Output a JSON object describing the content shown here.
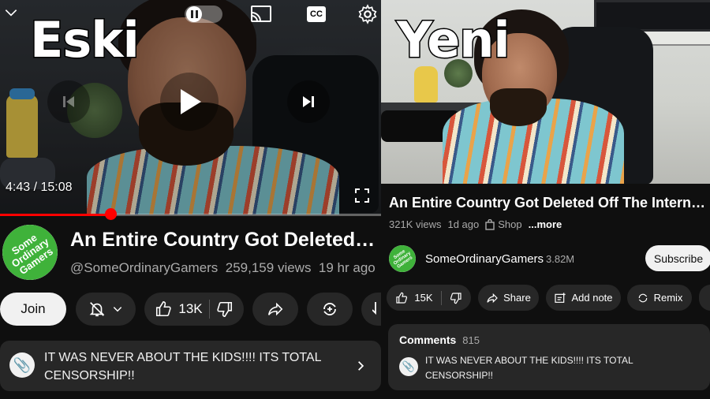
{
  "labels": {
    "old": "Eski",
    "new": "Yeni"
  },
  "video": {
    "title": "An Entire Country Got Deleted Off The Internet...",
    "channel": "SomeOrdinaryGamers",
    "channel_handle": "@SomeOrdinaryGamers",
    "avatar_text": "Some Ordinary Gamers"
  },
  "old_ui": {
    "time_current": "4:43",
    "time_total": "15:08",
    "time_display": "4:43 / 15:08",
    "progress": 0.29,
    "title": "An Entire Country Got Deleted Off…",
    "views": "259,159 views",
    "age": "19 hr ago",
    "more": "......",
    "join_label": "Join",
    "like_count": "13K",
    "comment_text": "IT WAS NEVER ABOUT THE KIDS!!!! ITS TOTAL CENSORSHIP!!"
  },
  "new_ui": {
    "title": "An Entire Country Got Deleted Off The Internet...",
    "views": "321K views",
    "age": "1d ago",
    "shop_label": "Shop",
    "more_label": "...more",
    "subscribers": "3.82M",
    "subscribe_label": "Subscribe",
    "like_count": "15K",
    "share_label": "Share",
    "add_note_label": "Add note",
    "remix_label": "Remix",
    "comments_label": "Comments",
    "comments_count": "815",
    "comment_text": "IT WAS NEVER ABOUT THE KIDS!!!! ITS TOTAL CENSORSHIP!!"
  },
  "colors": {
    "accent": "#ff0000",
    "background": "#0f0f0f",
    "pill": "#272727",
    "avatar_green": "#3fb23a"
  },
  "icons": [
    "chevron-down-icon",
    "pause-toggle-icon",
    "cast-icon",
    "cc-icon",
    "settings-gear-icon",
    "previous-icon",
    "play-icon",
    "next-icon",
    "fullscreen-icon",
    "bell-off-icon",
    "like-icon",
    "dislike-icon",
    "share-icon",
    "remix-icon",
    "download-icon",
    "shop-icon",
    "add-note-icon",
    "chevron-right-icon"
  ]
}
